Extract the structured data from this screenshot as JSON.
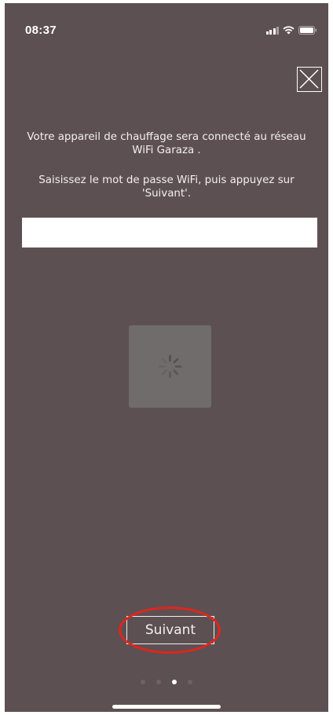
{
  "status_bar": {
    "time": "08:37"
  },
  "dialog": {
    "close_label": "close",
    "message_connect": "Votre appareil de chauffage sera connecté au réseau WiFi Garaza .",
    "message_instruction": "Saisissez le mot de passe WiFi, puis appuyez sur 'Suivant'.",
    "password": {
      "value": "",
      "placeholder": ""
    },
    "next_label": "Suivant"
  },
  "pagination": {
    "total": 4,
    "active_index": 2
  },
  "colors": {
    "background": "#5d5053",
    "loading_box": "#6f6c6b",
    "highlight": "#e1251b"
  },
  "icons": [
    "signal-icon",
    "wifi-icon",
    "battery-icon",
    "close-icon",
    "spinner-icon"
  ]
}
